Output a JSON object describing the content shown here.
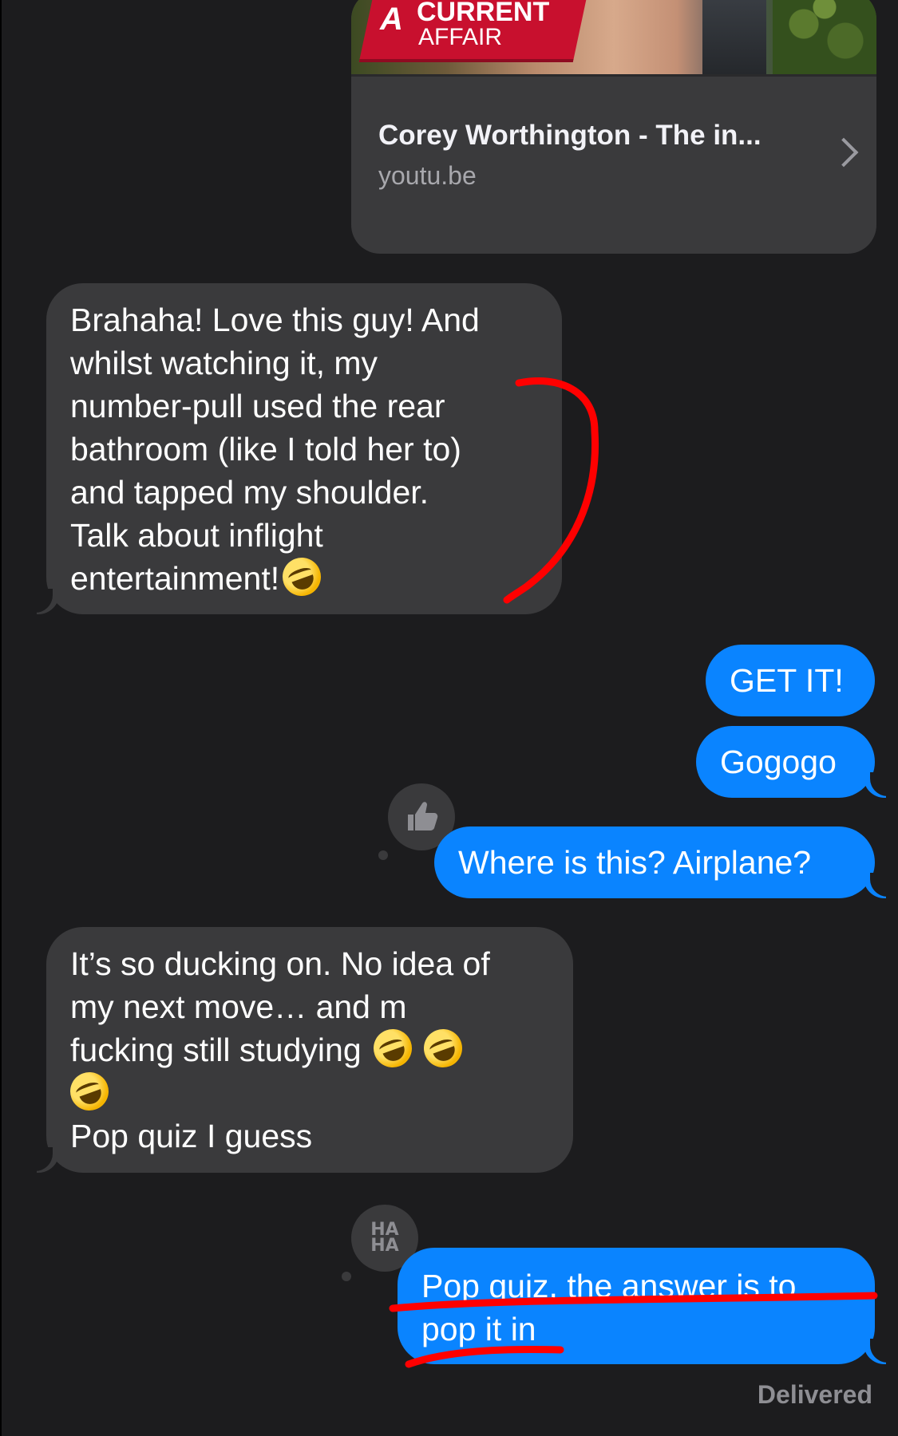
{
  "link_preview": {
    "logo_letter": "A",
    "logo_line1": "CURRENT",
    "logo_line2": "AFFAIR",
    "title": "Corey Worthington - The in...",
    "domain": "youtu.be",
    "chevron_icon": "chevron-right-icon"
  },
  "messages": [
    {
      "side": "received",
      "lines": [
        "Brahaha! Love this guy! And",
        "whilst watching it, my",
        "number-pull used the rear",
        "bathroom (like I told her to)",
        "and tapped my shoulder.",
        "Talk about inflight",
        "entertainment!"
      ],
      "trailing_emoji": "rolling-on-floor-laughing"
    },
    {
      "side": "sent",
      "text": "GET IT!"
    },
    {
      "side": "sent",
      "text": "Gogogo"
    },
    {
      "side": "sent",
      "text": "Where is this? Airplane?",
      "tapback": "thumbs-up"
    },
    {
      "side": "received",
      "lines": [
        "It’s so ducking on. No idea of",
        "my next move… and m",
        "fucking still studying",
        "",
        "Pop quiz I guess"
      ],
      "emojis": [
        "rolling-on-floor-laughing",
        "rolling-on-floor-laughing",
        "rolling-on-floor-laughing"
      ]
    },
    {
      "side": "sent",
      "lines": [
        "Pop quiz, the answer is to",
        "pop it in"
      ],
      "tapback": "haha",
      "tapback_text": "HA HA"
    }
  ],
  "status": "Delivered",
  "colors": {
    "background": "#1c1c1e",
    "received_bubble": "#3a3a3c",
    "sent_bubble": "#0a84ff",
    "annotation": "#ff0000"
  }
}
